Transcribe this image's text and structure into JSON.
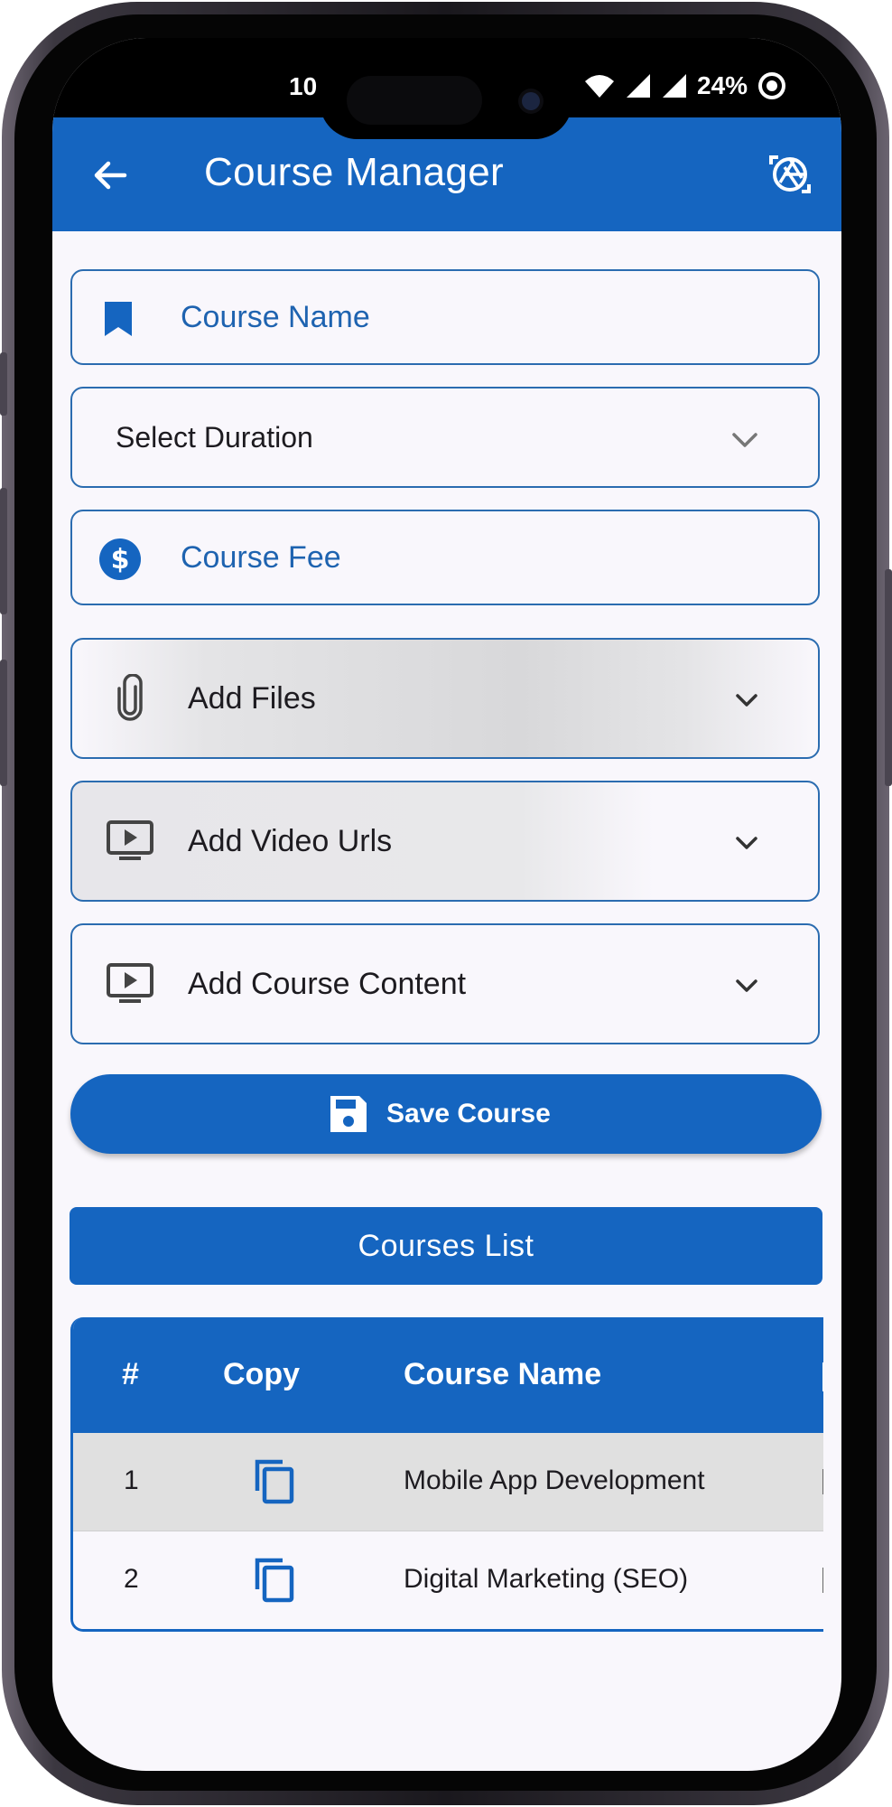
{
  "status_bar": {
    "time": "10",
    "battery": "24%"
  },
  "app_bar": {
    "title": "Course Manager"
  },
  "form": {
    "course_name_placeholder": "Course Name",
    "duration_label": "Select Duration",
    "course_fee_placeholder": "Course Fee",
    "add_files_label": "Add Files",
    "add_video_urls_label": "Add Video Urls",
    "add_course_content_label": "Add Course Content",
    "save_label": "Save Course"
  },
  "courses_list": {
    "title": "Courses List",
    "columns": [
      "#",
      "Copy",
      "Course Name"
    ],
    "rows": [
      {
        "index": "1",
        "name": "Mobile App Development"
      },
      {
        "index": "2",
        "name": "Digital Marketing (SEO)"
      }
    ]
  },
  "colors": {
    "primary": "#1565c0",
    "field_border": "#2b6cb0",
    "background": "#f9f7fc"
  },
  "icons": [
    "back-arrow-icon",
    "camera-lens-icon",
    "bookmark-icon",
    "dollar-circle-icon",
    "chevron-down-icon",
    "paperclip-icon",
    "video-play-icon",
    "save-floppy-icon",
    "copy-icon"
  ]
}
